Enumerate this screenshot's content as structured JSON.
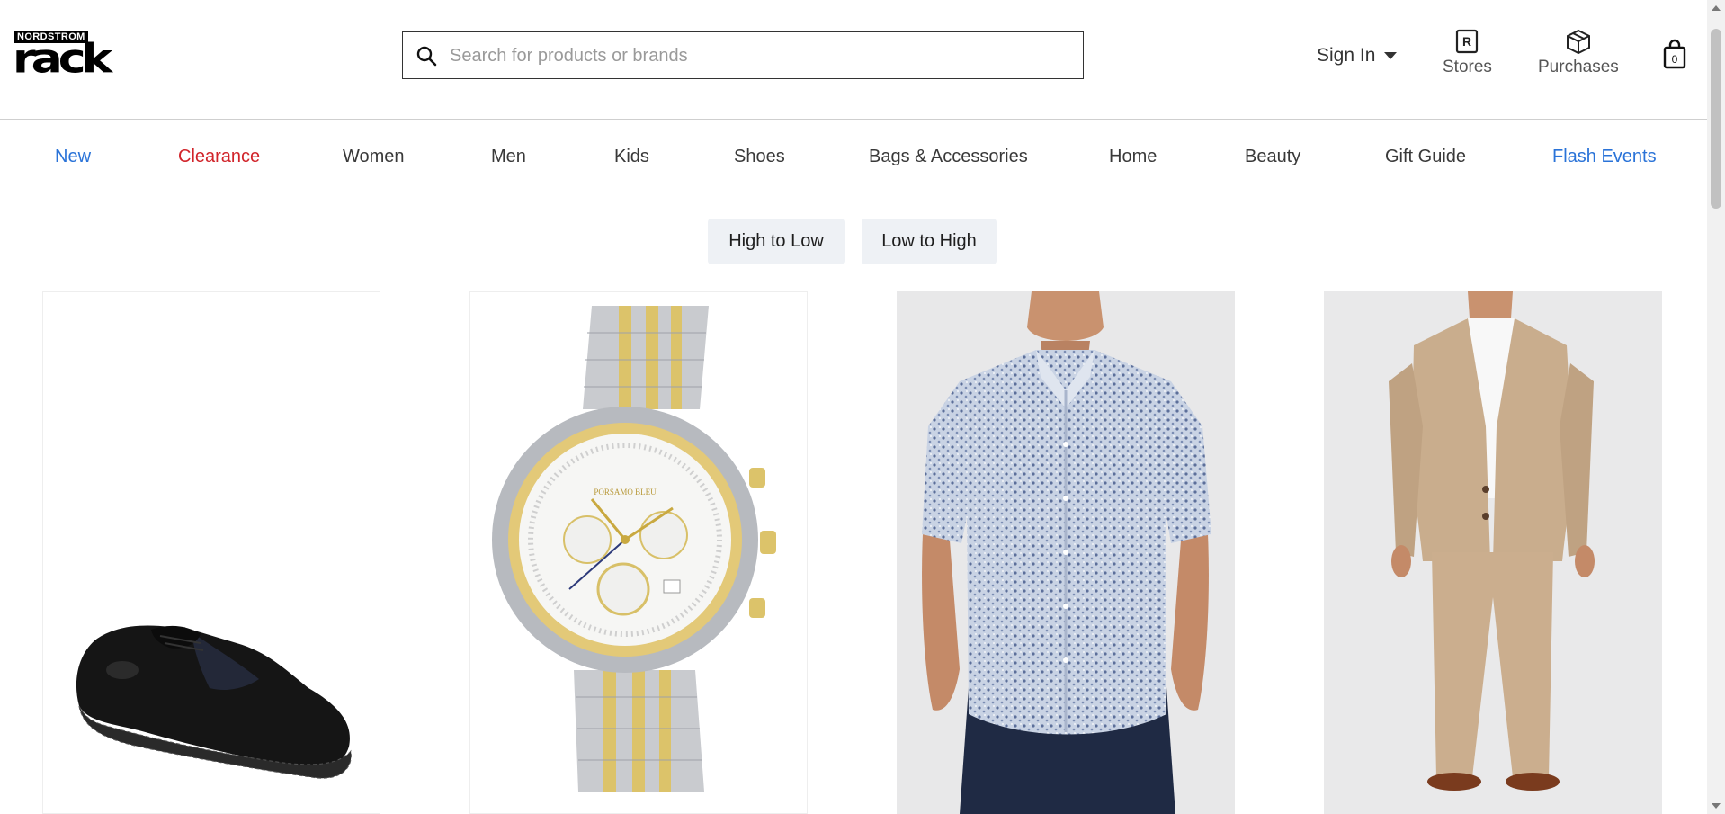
{
  "header": {
    "logo_small": "NORDSTROM",
    "logo_big": "Rack",
    "search_placeholder": "Search for products or brands",
    "sign_in": "Sign In",
    "stores": "Stores",
    "purchases": "Purchases",
    "bag_count": "0"
  },
  "nav": {
    "items": [
      {
        "label": "New",
        "color": "#2a73d8"
      },
      {
        "label": "Clearance",
        "color": "#d1242a"
      },
      {
        "label": "Women"
      },
      {
        "label": "Men"
      },
      {
        "label": "Kids"
      },
      {
        "label": "Shoes"
      },
      {
        "label": "Bags & Accessories"
      },
      {
        "label": "Home"
      },
      {
        "label": "Beauty"
      },
      {
        "label": "Gift Guide"
      },
      {
        "label": "Flash Events",
        "color": "#2a73d8"
      }
    ]
  },
  "sort": {
    "high_to_low": "High to Low",
    "low_to_high": "Low to High"
  },
  "products": [
    {
      "image": "black wingtip derby shoe"
    },
    {
      "image": "two-tone chronograph watch",
      "watch_brand": "PORSAMO BLEU"
    },
    {
      "image": "short sleeve floral print shirt"
    },
    {
      "image": "tan suit"
    }
  ]
}
